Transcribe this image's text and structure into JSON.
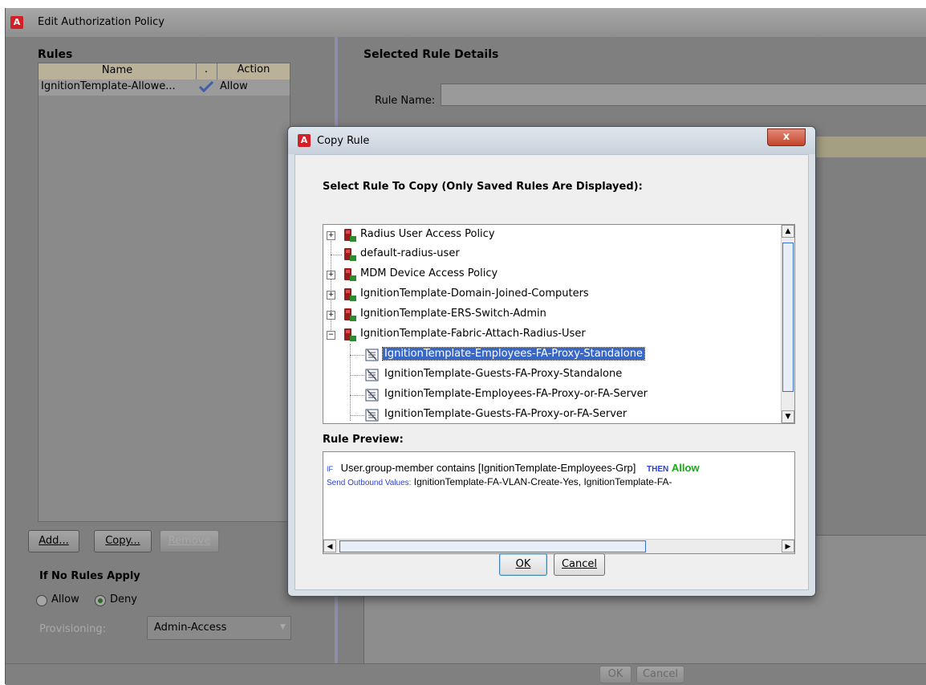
{
  "main_window": {
    "title": "Edit Authorization Policy",
    "app_icon": "A",
    "rules_heading": "Rules",
    "columns": {
      "name": "Name",
      "enabled": ".",
      "action": "Action"
    },
    "rows": [
      {
        "name": "IgnitionTemplate-Allowe...",
        "enabled_icon": "checkmark-icon",
        "action": "Allow"
      }
    ],
    "buttons": {
      "add": "Add...",
      "copy": "Copy...",
      "remove": "Remove"
    },
    "if_no_rules_heading": "If No Rules Apply",
    "radio_allow": "Allow",
    "radio_deny": "Deny",
    "radio_selected": "Deny",
    "provisioning_label": "Provisioning:",
    "provisioning_value": "Admin-Access",
    "selected_rule_heading": "Selected Rule Details",
    "rule_name_label": "Rule Name:",
    "rule_name_value": "",
    "footer_ok": "OK",
    "footer_cancel": "Cancel"
  },
  "dialog": {
    "title": "Copy Rule",
    "close_label": "x",
    "select_label": "Select Rule To Copy (Only Saved Rules Are Displayed):",
    "tree": [
      {
        "label": "Radius User Access Policy",
        "type": "policy",
        "expander": "+"
      },
      {
        "label": "default-radius-user",
        "type": "policy",
        "expander": ""
      },
      {
        "label": "MDM Device Access Policy",
        "type": "policy",
        "expander": "+"
      },
      {
        "label": "IgnitionTemplate-Domain-Joined-Computers",
        "type": "policy",
        "expander": "+"
      },
      {
        "label": "IgnitionTemplate-ERS-Switch-Admin",
        "type": "policy",
        "expander": "+"
      },
      {
        "label": "IgnitionTemplate-Fabric-Attach-Radius-User",
        "type": "policy",
        "expander": "−"
      },
      {
        "label": "IgnitionTemplate-Employees-FA-Proxy-Standalone",
        "type": "rule",
        "selected": true
      },
      {
        "label": "IgnitionTemplate-Guests-FA-Proxy-Standalone",
        "type": "rule"
      },
      {
        "label": "IgnitionTemplate-Employees-FA-Proxy-or-FA-Server",
        "type": "rule"
      },
      {
        "label": "IgnitionTemplate-Guests-FA-Proxy-or-FA-Server",
        "type": "rule"
      }
    ],
    "preview_label": "Rule Preview:",
    "preview": {
      "if_keyword": "IF",
      "condition": "User.group-member contains [IgnitionTemplate-Employees-Grp]",
      "then_keyword": "THEN",
      "action": "Allow",
      "send_label": "Send Outbound Values:",
      "send_values": "IgnitionTemplate-FA-VLAN-Create-Yes, IgnitionTemplate-FA-"
    },
    "ok_label": "OK",
    "cancel_label": "Cancel"
  },
  "colors": {
    "selection": "#3867c7",
    "allow_green": "#1aa81a",
    "keyword_blue": "#2a3fd8",
    "app_icon_red": "#d31f26"
  }
}
